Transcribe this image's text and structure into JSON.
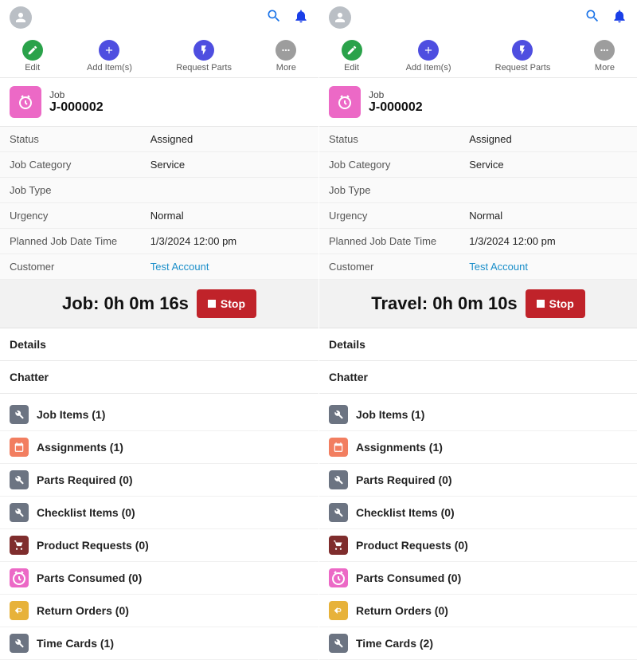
{
  "panes": [
    {
      "actions": [
        {
          "label": "Edit",
          "icon": "edit",
          "bg": "green"
        },
        {
          "label": "Add Item(s)",
          "icon": "plus",
          "bg": "blue"
        },
        {
          "label": "Request Parts",
          "icon": "bolt",
          "bg": "blue"
        },
        {
          "label": "More",
          "icon": "more",
          "bg": "grey"
        }
      ],
      "job": {
        "tag": "Job",
        "id": "J-000002"
      },
      "fields": [
        {
          "label": "Status",
          "value": "Assigned"
        },
        {
          "label": "Job Category",
          "value": "Service"
        },
        {
          "label": "Job Type",
          "value": ""
        },
        {
          "label": "Urgency",
          "value": "Normal"
        },
        {
          "label": "Planned Job Date Time",
          "value": "1/3/2024 12:00 pm"
        },
        {
          "label": "Customer",
          "value": "Test Account",
          "link": true
        }
      ],
      "timer": {
        "label": "Job: 0h 0m 16s",
        "button": "Stop"
      },
      "sections": {
        "details": "Details",
        "chatter": "Chatter"
      },
      "related": [
        {
          "label": "Job Items (1)",
          "bg": "slate",
          "icon": "wrench"
        },
        {
          "label": "Assignments (1)",
          "bg": "coral",
          "icon": "calendar"
        },
        {
          "label": "Parts Required (0)",
          "bg": "slate",
          "icon": "wrench"
        },
        {
          "label": "Checklist Items (0)",
          "bg": "slate",
          "icon": "wrench"
        },
        {
          "label": "Product Requests (0)",
          "bg": "maroon",
          "icon": "cart"
        },
        {
          "label": "Parts Consumed (0)",
          "bg": "pink",
          "icon": "clock"
        },
        {
          "label": "Return Orders (0)",
          "bg": "gold",
          "icon": "return"
        },
        {
          "label": "Time Cards (1)",
          "bg": "slate",
          "icon": "wrench"
        }
      ]
    },
    {
      "actions": [
        {
          "label": "Edit",
          "icon": "edit",
          "bg": "green"
        },
        {
          "label": "Add Item(s)",
          "icon": "plus",
          "bg": "blue"
        },
        {
          "label": "Request Parts",
          "icon": "bolt",
          "bg": "blue"
        },
        {
          "label": "More",
          "icon": "more",
          "bg": "grey"
        }
      ],
      "job": {
        "tag": "Job",
        "id": "J-000002"
      },
      "fields": [
        {
          "label": "Status",
          "value": "Assigned"
        },
        {
          "label": "Job Category",
          "value": "Service"
        },
        {
          "label": "Job Type",
          "value": ""
        },
        {
          "label": "Urgency",
          "value": "Normal"
        },
        {
          "label": "Planned Job Date Time",
          "value": "1/3/2024 12:00 pm"
        },
        {
          "label": "Customer",
          "value": "Test Account",
          "link": true
        }
      ],
      "timer": {
        "label": "Travel: 0h 0m 10s",
        "button": "Stop"
      },
      "sections": {
        "details": "Details",
        "chatter": "Chatter"
      },
      "related": [
        {
          "label": "Job Items (1)",
          "bg": "slate",
          "icon": "wrench"
        },
        {
          "label": "Assignments (1)",
          "bg": "coral",
          "icon": "calendar"
        },
        {
          "label": "Parts Required (0)",
          "bg": "slate",
          "icon": "wrench"
        },
        {
          "label": "Checklist Items (0)",
          "bg": "slate",
          "icon": "wrench"
        },
        {
          "label": "Product Requests (0)",
          "bg": "maroon",
          "icon": "cart"
        },
        {
          "label": "Parts Consumed (0)",
          "bg": "pink",
          "icon": "clock"
        },
        {
          "label": "Return Orders (0)",
          "bg": "gold",
          "icon": "return"
        },
        {
          "label": "Time Cards (2)",
          "bg": "slate",
          "icon": "wrench"
        }
      ]
    }
  ]
}
